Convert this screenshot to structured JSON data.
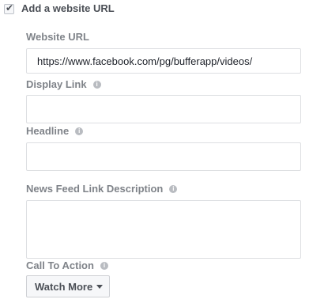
{
  "website_url_toggle": {
    "label": "Add a website URL",
    "checked": true,
    "icon": "checkmark-icon"
  },
  "fields": {
    "website_url": {
      "label": "Website URL",
      "value": "https://www.facebook.com/pg/bufferapp/videos/"
    },
    "display_link": {
      "label": "Display Link",
      "value": "",
      "info_icon": "info-icon"
    },
    "headline": {
      "label": "Headline",
      "value": "",
      "info_icon": "info-icon"
    },
    "news_feed_link_description": {
      "label": "News Feed Link Description",
      "value": "",
      "info_icon": "info-icon"
    },
    "call_to_action": {
      "label": "Call To Action",
      "info_icon": "info-icon",
      "selected": "Watch More",
      "dropdown_icon": "caret-down-icon"
    }
  },
  "info_glyph": "i",
  "colors": {
    "label_gray": "#7f8389",
    "text_dark": "#4b4f56",
    "border": "#dddfe2",
    "button_bg": "#f6f7f9"
  }
}
